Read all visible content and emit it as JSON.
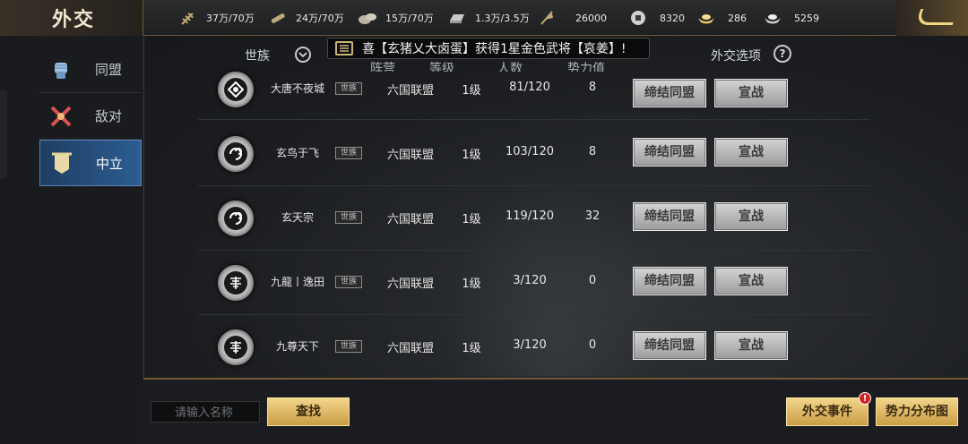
{
  "window": {
    "title": "外交"
  },
  "resources": [
    {
      "icon": "wheat-icon",
      "value": "37万/70万"
    },
    {
      "icon": "wood-icon",
      "value": "24万/70万"
    },
    {
      "icon": "stone-icon",
      "value": "15万/70万"
    },
    {
      "icon": "iron-ingot-icon",
      "value": "1.3万/3.5万"
    },
    {
      "icon": "banner-icon",
      "value": "26000"
    },
    {
      "icon": "coin-icon",
      "value": "8320"
    },
    {
      "icon": "gold-ingot-icon",
      "value": "286"
    },
    {
      "icon": "silver-ingot-icon",
      "value": "5259"
    }
  ],
  "sidebar": {
    "items": [
      {
        "label": "同盟",
        "icon": "fist-icon",
        "active": false
      },
      {
        "label": "敌对",
        "icon": "crossed-swords-icon",
        "active": false
      },
      {
        "label": "中立",
        "icon": "scroll-flag-icon",
        "active": true
      }
    ]
  },
  "header": {
    "clan_filter": "世族",
    "options_label": "外交选项",
    "options_help": "?",
    "partial_columns": [
      "阵营",
      "等级",
      "人数",
      "势力值"
    ]
  },
  "announcement": "喜【玄猪乂大卤蛋】获得1星金色武将【哀姜】!",
  "clans": [
    {
      "emblem": "lotus-emblem-icon",
      "name": "大唐不夜城",
      "tag": "世族",
      "camp": "六国联盟",
      "level": "1级",
      "members": "81/120",
      "power": "8"
    },
    {
      "emblem": "swirl-emblem-icon",
      "name": "玄鸟于飞",
      "tag": "世族",
      "camp": "六国联盟",
      "level": "1级",
      "members": "103/120",
      "power": "8"
    },
    {
      "emblem": "swirl-emblem-icon",
      "name": "玄天宗",
      "tag": "世族",
      "camp": "六国联盟",
      "level": "1级",
      "members": "119/120",
      "power": "32"
    },
    {
      "emblem": "shou-emblem-icon",
      "name": "九龍丨逸田",
      "tag": "世族",
      "camp": "六国联盟",
      "level": "1级",
      "members": "3/120",
      "power": "0"
    },
    {
      "emblem": "shou-emblem-icon",
      "name": "九尊天下",
      "tag": "世族",
      "camp": "六国联盟",
      "level": "1级",
      "members": "3/120",
      "power": "0"
    }
  ],
  "row_buttons": {
    "ally": "缔结同盟",
    "war": "宣战"
  },
  "bottom": {
    "search_placeholder": "请输入名称",
    "search_button": "查找",
    "events_button": "外交事件",
    "events_badge": "!",
    "map_button": "势力分布图"
  },
  "colors": {
    "accent_gold": "#c99d45",
    "active_tab": "#2c5d91",
    "alert": "#d42222"
  }
}
